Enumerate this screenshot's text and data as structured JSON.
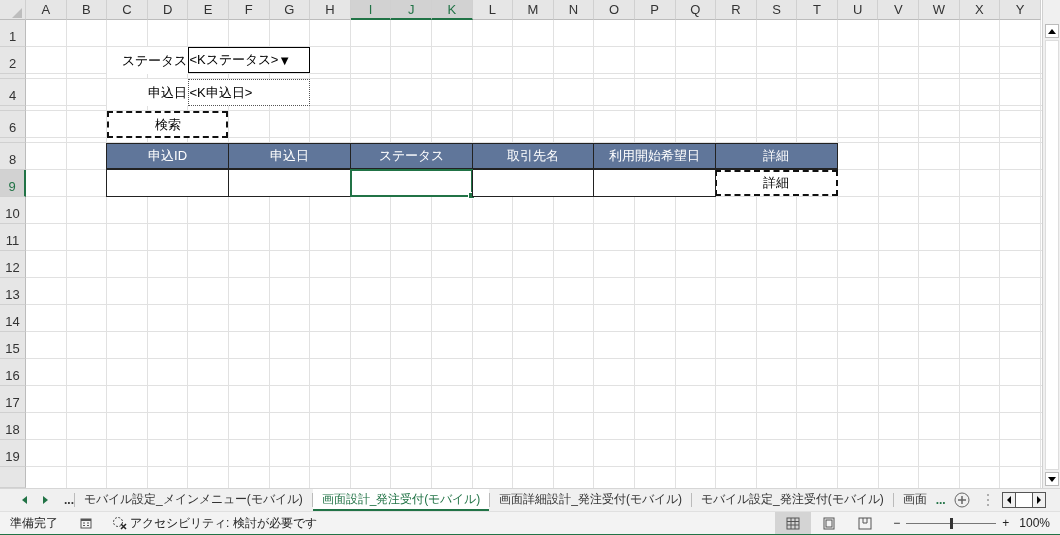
{
  "sheet": {
    "columns": [
      {
        "label": "A",
        "selected": false
      },
      {
        "label": "B",
        "selected": false
      },
      {
        "label": "C",
        "selected": false
      },
      {
        "label": "D",
        "selected": false
      },
      {
        "label": "E",
        "selected": false
      },
      {
        "label": "F",
        "selected": false
      },
      {
        "label": "G",
        "selected": false
      },
      {
        "label": "H",
        "selected": false
      },
      {
        "label": "I",
        "selected": true
      },
      {
        "label": "J",
        "selected": true
      },
      {
        "label": "K",
        "selected": true
      },
      {
        "label": "L",
        "selected": false
      },
      {
        "label": "M",
        "selected": false
      },
      {
        "label": "N",
        "selected": false
      },
      {
        "label": "O",
        "selected": false
      },
      {
        "label": "P",
        "selected": false
      },
      {
        "label": "Q",
        "selected": false
      },
      {
        "label": "R",
        "selected": false
      },
      {
        "label": "S",
        "selected": false
      },
      {
        "label": "T",
        "selected": false
      },
      {
        "label": "U",
        "selected": false
      },
      {
        "label": "V",
        "selected": false
      },
      {
        "label": "W",
        "selected": false
      },
      {
        "label": "X",
        "selected": false
      },
      {
        "label": "Y",
        "selected": false
      }
    ],
    "rows": [
      {
        "kind": "row",
        "label": "1",
        "selected": false
      },
      {
        "kind": "row",
        "label": "2",
        "selected": false
      },
      {
        "kind": "spacer",
        "selected": false
      },
      {
        "kind": "row",
        "label": "4",
        "selected": false
      },
      {
        "kind": "spacer",
        "selected": false
      },
      {
        "kind": "row",
        "label": "6",
        "selected": false
      },
      {
        "kind": "spacer",
        "selected": false
      },
      {
        "kind": "row",
        "label": "8",
        "selected": false
      },
      {
        "kind": "row",
        "label": "9",
        "selected": true
      },
      {
        "kind": "row",
        "label": "10",
        "selected": false
      },
      {
        "kind": "row",
        "label": "11",
        "selected": false
      },
      {
        "kind": "row",
        "label": "12",
        "selected": false
      },
      {
        "kind": "row",
        "label": "13",
        "selected": false
      },
      {
        "kind": "row",
        "label": "14",
        "selected": false
      },
      {
        "kind": "row",
        "label": "15",
        "selected": false
      },
      {
        "kind": "row",
        "label": "16",
        "selected": false
      },
      {
        "kind": "row",
        "label": "17",
        "selected": false
      },
      {
        "kind": "row",
        "label": "18",
        "selected": false
      },
      {
        "kind": "row",
        "label": "19",
        "selected": false
      }
    ],
    "form": {
      "status_label": "ステータス",
      "status_field": {
        "value": "<Kステータス>",
        "dropdown_glyph": "▼"
      },
      "date_label": "申込日",
      "date_field": {
        "value": "<K申込日>"
      },
      "search_button": "検索"
    },
    "table": {
      "columns": [
        "申込ID",
        "申込日",
        "ステータス",
        "取引先名",
        "利用開始希望日",
        "詳細"
      ],
      "rows": [
        {
          "cells": [
            {
              "kind": "blank",
              "selected": false
            },
            {
              "kind": "blank",
              "selected": false
            },
            {
              "kind": "blank",
              "selected": true
            },
            {
              "kind": "blank",
              "selected": false
            },
            {
              "kind": "blank",
              "selected": false
            },
            {
              "kind": "button",
              "label": "詳細",
              "selected": false
            }
          ]
        }
      ]
    }
  },
  "sheet_tabs": {
    "overflow": "...",
    "tabs": [
      {
        "label": "モバイル設定_メインメニュー(モバイル)",
        "selected": false
      },
      {
        "label": "画面設計_発注受付(モバイル)",
        "selected": true
      },
      {
        "label": "画面詳細設計_発注受付(モバイル)",
        "selected": false
      },
      {
        "label": "モバイル設定_発注受付(モバイル)",
        "selected": false
      },
      {
        "label": "画面",
        "selected": false
      }
    ],
    "more": "..."
  },
  "status_bar": {
    "ready": "準備完了",
    "accessibility": "アクセシビリティ: 検討が必要です",
    "views": [
      {
        "kind": "normal",
        "selected": true
      },
      {
        "kind": "page_layout",
        "selected": false
      },
      {
        "kind": "page_break",
        "selected": false
      }
    ],
    "zoom": {
      "minus": "−",
      "plus": "+",
      "level": 0.5,
      "reading": "100%"
    }
  }
}
